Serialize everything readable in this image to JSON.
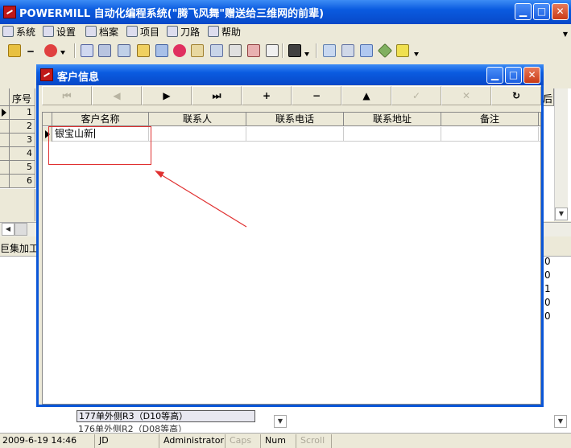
{
  "app": {
    "title": "POWERMILL 自动化编程系统(\"腾飞风舞\"赠送给三维网的前辈)",
    "window_buttons": {
      "minimize": "▁",
      "maximize": "□",
      "close": "✕"
    }
  },
  "menu": {
    "items": [
      {
        "label": "系统",
        "icon": "system-icon"
      },
      {
        "label": "设置",
        "icon": "settings-icon"
      },
      {
        "label": "档案",
        "icon": "file-icon"
      },
      {
        "label": "项目",
        "icon": "project-icon"
      },
      {
        "label": "刀路",
        "icon": "toolpath-icon"
      },
      {
        "label": "帮助",
        "icon": "help-icon"
      }
    ]
  },
  "toolbar": {
    "icons": [
      "open-folder-icon",
      "minus-icon",
      "stop-icon",
      "dropdown-icon",
      "tool-icon",
      "gear-icon",
      "settings-icon",
      "edit-icon",
      "refresh-icon",
      "record-icon",
      "magic-wand-icon",
      "layers-icon",
      "print-icon",
      "export-icon",
      "calculator-icon",
      "save-icon",
      "dropdown-icon",
      "image-icon",
      "close-doc-icon",
      "image-icon",
      "diamond-icon",
      "highlight-icon",
      "dropdown-icon"
    ]
  },
  "background": {
    "grid_header_first": "序号",
    "grid_header_right": "后Ā",
    "row_numbers": [
      "1",
      "2",
      "3",
      "4",
      "5",
      "6"
    ],
    "panel_label": "巨集加工",
    "right_values": [
      "0",
      "0",
      "1",
      "0",
      "0"
    ],
    "list_item_selected": "177单外侧R3（D10等高）",
    "list_item_next": "176单外侧R2（D08等高）"
  },
  "dialog": {
    "title": "客户信息",
    "navigator": [
      {
        "label": "⏮",
        "name": "first-record-button",
        "disabled": true
      },
      {
        "label": "◀",
        "name": "prior-record-button",
        "disabled": true
      },
      {
        "label": "▶",
        "name": "next-record-button",
        "disabled": false
      },
      {
        "label": "⏭",
        "name": "last-record-button",
        "disabled": false
      },
      {
        "label": "+",
        "name": "insert-record-button",
        "disabled": false
      },
      {
        "label": "−",
        "name": "delete-record-button",
        "disabled": false
      },
      {
        "label": "▲",
        "name": "edit-record-button",
        "disabled": false
      },
      {
        "label": "✓",
        "name": "post-record-button",
        "disabled": true
      },
      {
        "label": "✕",
        "name": "cancel-record-button",
        "disabled": true
      },
      {
        "label": "↻",
        "name": "refresh-record-button",
        "disabled": false
      }
    ],
    "grid": {
      "columns": [
        "客户名称",
        "联系人",
        "联系电话",
        "联系地址",
        "备注"
      ],
      "rows": [
        {
          "customer_name": "银宝山新",
          "contact": "",
          "phone": "",
          "address": "",
          "note": ""
        }
      ]
    }
  },
  "statusbar": {
    "datetime": "2009-6-19 14:46",
    "user_code": "JD",
    "user": "Administrator",
    "caps": "Caps",
    "num": "Num",
    "scroll": "Scroll"
  },
  "colors": {
    "titlebar": "#0a5be0",
    "face": "#ece9d8",
    "annotation": "#e03030"
  }
}
